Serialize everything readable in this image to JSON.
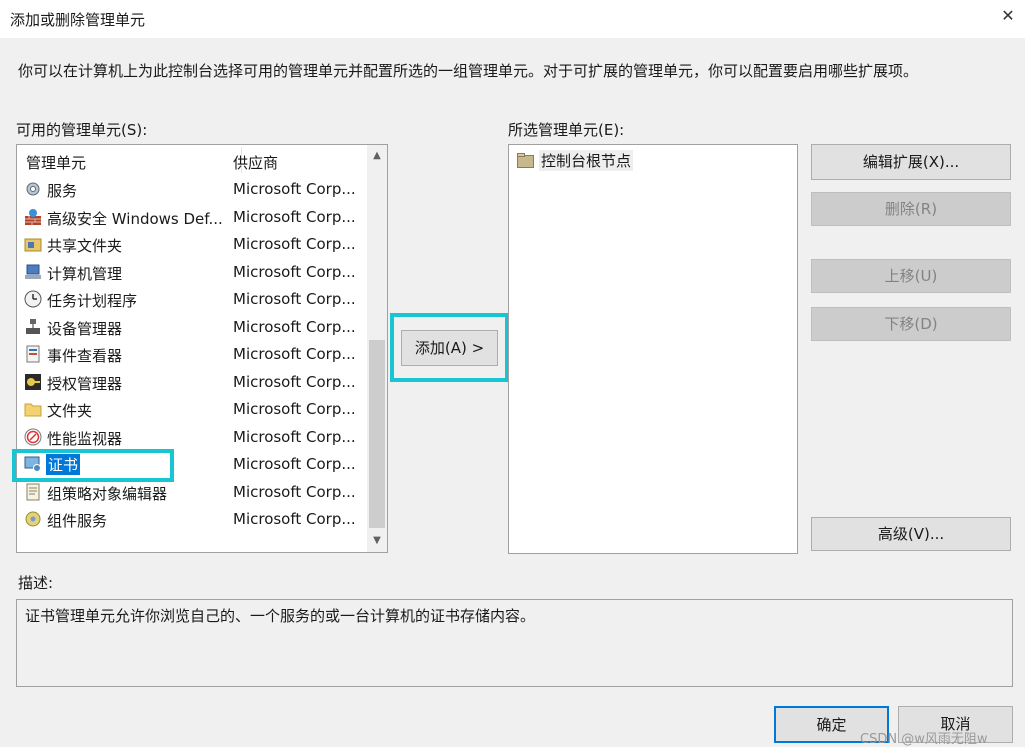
{
  "window": {
    "title": "添加或删除管理单元",
    "close_label": "✕"
  },
  "intro": "你可以在计算机上为此控制台选择可用的管理单元并配置所选的一组管理单元。对于可扩展的管理单元，你可以配置要启用哪些扩展项。",
  "available": {
    "label": "可用的管理单元(S):",
    "col_name": "管理单元",
    "col_vendor": "供应商",
    "items": [
      {
        "name": "服务",
        "vendor": "Microsoft Corp...",
        "icon": "gear-icon"
      },
      {
        "name": "高级安全 Windows Def...",
        "vendor": "Microsoft Corp...",
        "icon": "firewall-icon"
      },
      {
        "name": "共享文件夹",
        "vendor": "Microsoft Corp...",
        "icon": "shared-folder-icon"
      },
      {
        "name": "计算机管理",
        "vendor": "Microsoft Corp...",
        "icon": "computer-management-icon"
      },
      {
        "name": "任务计划程序",
        "vendor": "Microsoft Corp...",
        "icon": "clock-icon"
      },
      {
        "name": "设备管理器",
        "vendor": "Microsoft Corp...",
        "icon": "device-manager-icon"
      },
      {
        "name": "事件查看器",
        "vendor": "Microsoft Corp...",
        "icon": "event-viewer-icon"
      },
      {
        "name": "授权管理器",
        "vendor": "Microsoft Corp...",
        "icon": "authorization-icon"
      },
      {
        "name": "文件夹",
        "vendor": "Microsoft Corp...",
        "icon": "folder-icon"
      },
      {
        "name": "性能监视器",
        "vendor": "Microsoft Corp...",
        "icon": "performance-icon"
      },
      {
        "name": "证书",
        "vendor": "Microsoft Corp...",
        "icon": "certificate-icon",
        "selected": true
      },
      {
        "name": "组策略对象编辑器",
        "vendor": "Microsoft Corp...",
        "icon": "policy-icon"
      },
      {
        "name": "组件服务",
        "vendor": "Microsoft Corp...",
        "icon": "component-services-icon"
      }
    ]
  },
  "add_button": "添加(A) >",
  "selected": {
    "label": "所选管理单元(E):",
    "root": "控制台根节点"
  },
  "buttons": {
    "edit": "编辑扩展(X)...",
    "remove": "删除(R)",
    "move_up": "上移(U)",
    "move_down": "下移(D)",
    "advanced": "高级(V)...",
    "ok": "确定",
    "cancel": "取消"
  },
  "description": {
    "label": "描述:",
    "text": "证书管理单元允许你浏览自己的、一个服务的或一台计算机的证书存储内容。"
  },
  "watermark": "CSDN @w风雨无阻w",
  "colors": {
    "selection": "#0078d7",
    "highlight_frame": "#17c5d3"
  }
}
